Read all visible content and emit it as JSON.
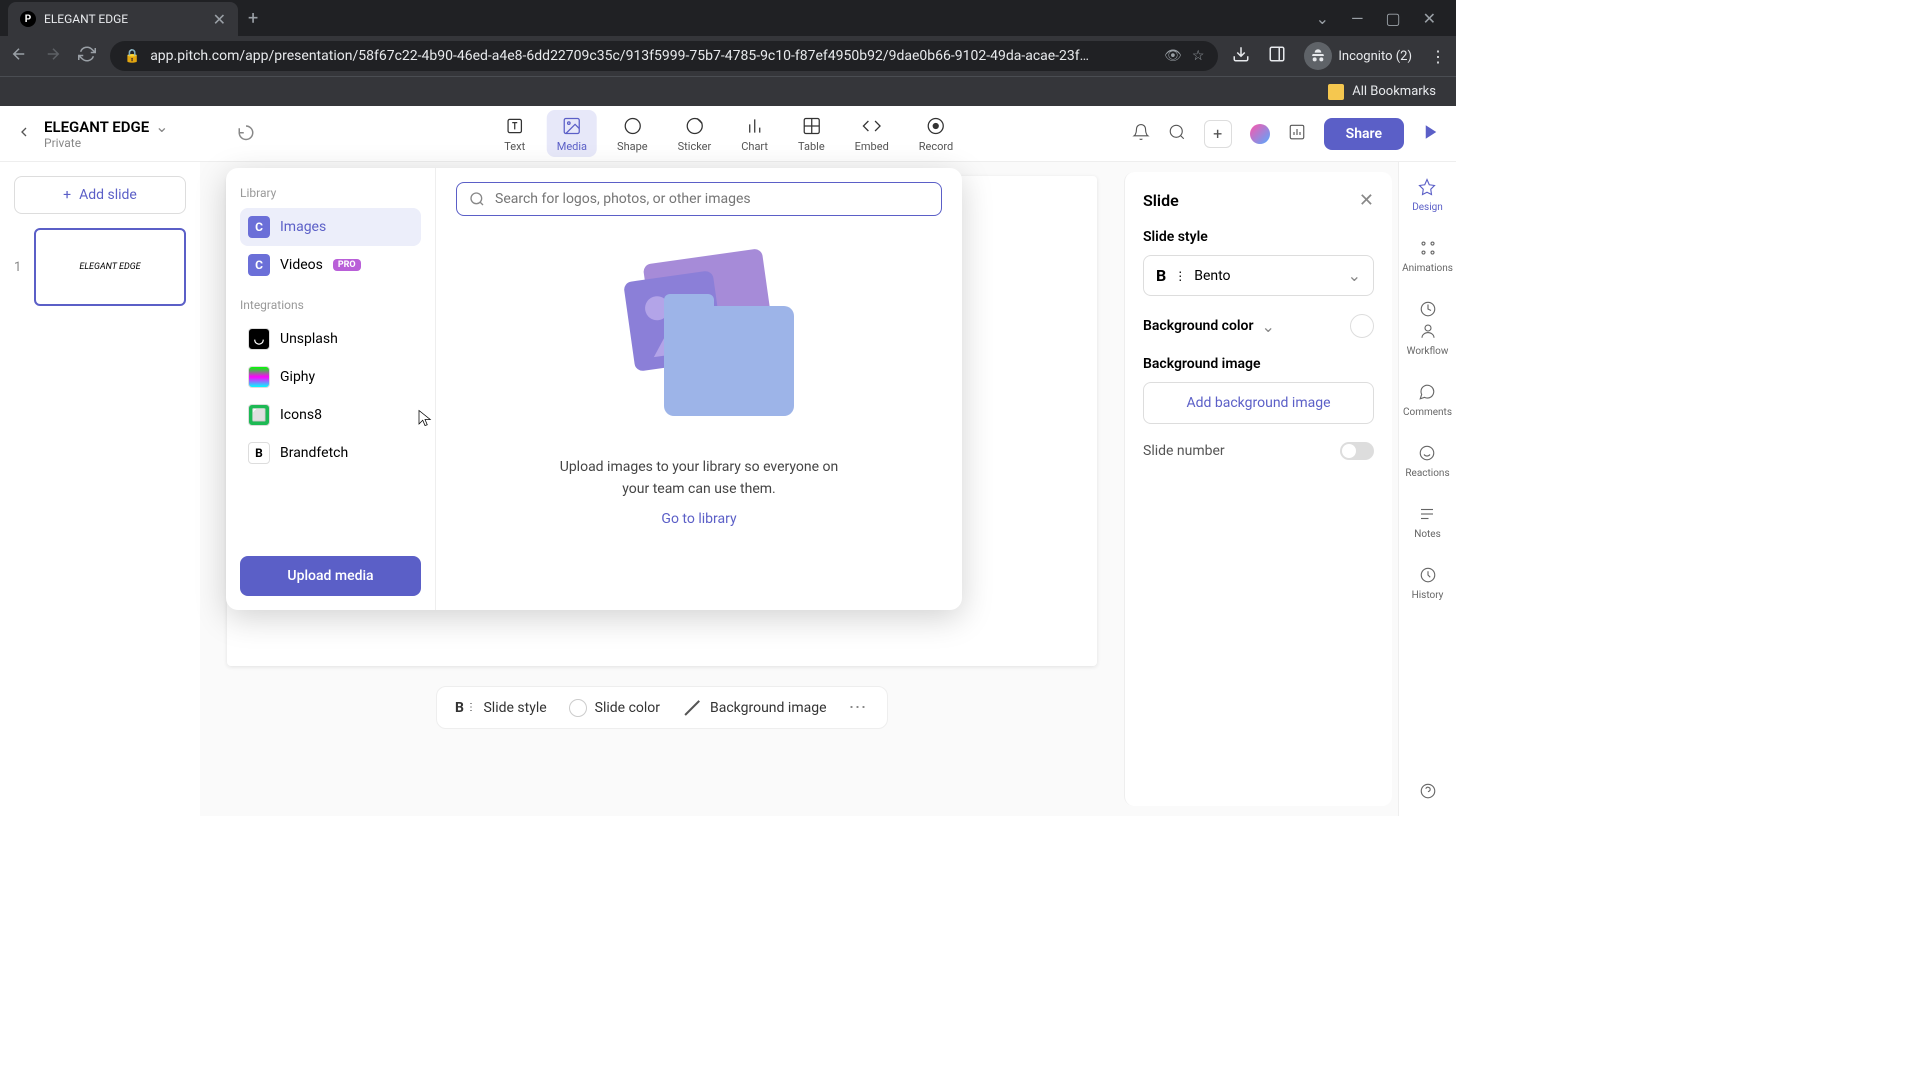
{
  "browser": {
    "tab_title": "ELEGANT EDGE",
    "url_display": "app.pitch.com/app/presentation/58f67c22-4b90-46ed-a4e8-6dd22709c35c/913f5999-75b7-4785-9c10-f87ef4950b92/9dae0b66-9102-49da-acae-23f…",
    "incognito_label": "Incognito (2)",
    "bookmarks_label": "All Bookmarks"
  },
  "header": {
    "doc_name": "ELEGANT EDGE",
    "doc_privacy": "Private"
  },
  "toolbar": {
    "text": "Text",
    "media": "Media",
    "shape": "Shape",
    "sticker": "Sticker",
    "chart": "Chart",
    "table": "Table",
    "embed": "Embed",
    "record": "Record",
    "share": "Share"
  },
  "slides": {
    "add_label": "Add slide",
    "items": [
      {
        "num": "1",
        "preview": "ELEGANT EDGE"
      }
    ]
  },
  "media": {
    "library_label": "Library",
    "images": "Images",
    "videos": "Videos",
    "pro": "PRO",
    "integrations_label": "Integrations",
    "unsplash": "Unsplash",
    "giphy": "Giphy",
    "icons8": "Icons8",
    "brandfetch": "Brandfetch",
    "upload_btn": "Upload media",
    "search_placeholder": "Search for logos, photos, or other images",
    "empty_line1": "Upload images to your library so everyone on",
    "empty_line2": "your team can use them.",
    "go_library": "Go to library"
  },
  "bottom": {
    "slide_style": "Slide style",
    "slide_color": "Slide color",
    "bg_image": "Background image"
  },
  "inspector": {
    "title": "Slide",
    "slide_style_label": "Slide style",
    "style_name": "Bento",
    "bg_color_label": "Background color",
    "bg_image_label": "Background image",
    "add_bg_btn": "Add background image",
    "slide_number_label": "Slide number"
  },
  "rail": {
    "design": "Design",
    "animations": "Animations",
    "workflow": "Workflow",
    "comments": "Comments",
    "reactions": "Reactions",
    "notes": "Notes",
    "history": "History"
  }
}
